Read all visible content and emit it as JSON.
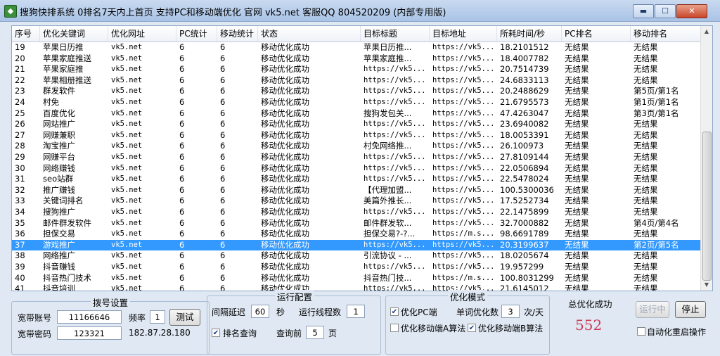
{
  "window": {
    "title": "搜狗快排系统 0排名7天内上首页 支持PC和移动端优化 官网 vk5.net 客服QQ 804520209 (内部专用版)",
    "min_icon": "minimize-icon",
    "max_icon": "maximize-icon",
    "close_icon": "close-icon"
  },
  "table": {
    "columns": [
      "序号",
      "优化关键词",
      "优化网址",
      "PC统计",
      "移动统计",
      "状态",
      "目标标题",
      "目标地址",
      "所耗时间/秒",
      "PC排名",
      "移动排名"
    ],
    "selected_row": 18,
    "rows": [
      [
        "19",
        "苹果日历推",
        "vk5.net",
        "6",
        "6",
        "移动优化成功",
        "苹果日历推...",
        "https://vk5...",
        "18.2101512",
        "无结果",
        "无结果"
      ],
      [
        "20",
        "苹果家庭推送",
        "vk5.net",
        "6",
        "6",
        "移动优化成功",
        "苹果家庭推...",
        "https://vk5...",
        "18.4007782",
        "无结果",
        "无结果"
      ],
      [
        "21",
        "苹果家庭推",
        "vk5.net",
        "6",
        "6",
        "移动优化成功",
        "https://vk5...",
        "https://vk5...",
        "20.7514739",
        "无结果",
        "无结果"
      ],
      [
        "22",
        "苹果相册推送",
        "vk5.net",
        "6",
        "6",
        "移动优化成功",
        "https://vk5...",
        "https://vk5...",
        "24.6833113",
        "无结果",
        "无结果"
      ],
      [
        "23",
        "群发软件",
        "vk5.net",
        "6",
        "6",
        "移动优化成功",
        "https://vk5...",
        "https://vk5...",
        "20.2488629",
        "无结果",
        "第5页/第1名"
      ],
      [
        "24",
        "村免",
        "vk5.net",
        "6",
        "6",
        "移动优化成功",
        "https://vk5...",
        "https://vk5...",
        "21.6795573",
        "无结果",
        "第1页/第1名"
      ],
      [
        "25",
        "百度优化",
        "vk5.net",
        "6",
        "6",
        "移动优化成功",
        "搜狗发包关...",
        "https://vk5...",
        "47.4263047",
        "无结果",
        "第3页/第1名"
      ],
      [
        "26",
        "网站推广",
        "vk5.net",
        "6",
        "6",
        "移动优化成功",
        "https://vk5...",
        "https://vk5...",
        "23.6940082",
        "无结果",
        "无结果"
      ],
      [
        "27",
        "网赚兼职",
        "vk5.net",
        "6",
        "6",
        "移动优化成功",
        "https://vk5...",
        "https://vk5...",
        "18.0053391",
        "无结果",
        "无结果"
      ],
      [
        "28",
        "淘宝推广",
        "vk5.net",
        "6",
        "6",
        "移动优化成功",
        "村免网络推...",
        "https://vk5...",
        "26.100973",
        "无结果",
        "无结果"
      ],
      [
        "29",
        "网赚平台",
        "vk5.net",
        "6",
        "6",
        "移动优化成功",
        "https://vk5...",
        "https://vk5...",
        "27.8109144",
        "无结果",
        "无结果"
      ],
      [
        "30",
        "网络赚钱",
        "vk5.net",
        "6",
        "6",
        "移动优化成功",
        "https://vk5...",
        "https://vk5...",
        "22.0506894",
        "无结果",
        "无结果"
      ],
      [
        "31",
        "seo站群",
        "vk5.net",
        "6",
        "6",
        "移动优化成功",
        "https://vk5...",
        "https://vk5...",
        "22.5478024",
        "无结果",
        "无结果"
      ],
      [
        "32",
        "推广赚钱",
        "vk5.net",
        "6",
        "6",
        "移动优化成功",
        "【代理加盟...",
        "https://vk5...",
        "100.5300036",
        "无结果",
        "无结果"
      ],
      [
        "33",
        "关键词排名",
        "vk5.net",
        "6",
        "6",
        "移动优化成功",
        "美篇外推长...",
        "https://vk5...",
        "17.5252734",
        "无结果",
        "无结果"
      ],
      [
        "34",
        "搜狗推广",
        "vk5.net",
        "6",
        "6",
        "移动优化成功",
        "https://vk5...",
        "https://vk5...",
        "22.1475899",
        "无结果",
        "无结果"
      ],
      [
        "35",
        "邮件群发软件",
        "vk5.net",
        "6",
        "6",
        "移动优化成功",
        "邮件群发软...",
        "https://vk5...",
        "32.7000882",
        "无结果",
        "第4页/第4名"
      ],
      [
        "36",
        "担保交易",
        "vk5.net",
        "6",
        "6",
        "移动优化成功",
        "担保交易?-?...",
        "https://m.s...",
        "98.6691789",
        "无结果",
        "无结果"
      ],
      [
        "37",
        "游戏推广",
        "vk5.net",
        "6",
        "6",
        "移动优化成功",
        "https://vk5...",
        "https://vk5...",
        "20.3199637",
        "无结果",
        "第2页/第5名"
      ],
      [
        "38",
        "网络推广",
        "vk5.net",
        "6",
        "6",
        "移动优化成功",
        "引流协议 - ...",
        "https://vk5...",
        "18.0205674",
        "无结果",
        "无结果"
      ],
      [
        "39",
        "抖音赚钱",
        "vk5.net",
        "6",
        "6",
        "移动优化成功",
        "https://vk5...",
        "https://vk5...",
        "19.957299",
        "无结果",
        "无结果"
      ],
      [
        "40",
        "抖音热门技术",
        "vk5.net",
        "6",
        "6",
        "移动优化成功",
        "抖音热门技...",
        "https://m.s...",
        "100.8031299",
        "无结果",
        "无结果"
      ],
      [
        "41",
        "抖音培训",
        "vk5.net",
        "6",
        "6",
        "移动优化成功",
        "https://vk5...",
        "https://vk5...",
        "21.6145012",
        "无结果",
        "无结果"
      ]
    ]
  },
  "dial": {
    "title": "拨号设置",
    "account_label": "宽带账号",
    "account_value": "11166646",
    "password_label": "宽带密码",
    "password_value": "123321",
    "freq_label": "频率",
    "freq_value": "1",
    "test_button": "测试",
    "ip": "182.87.28.180"
  },
  "run": {
    "title": "运行配置",
    "interval_label": "间隔延迟",
    "interval_value": "60",
    "interval_unit": "秒",
    "threads_label": "运行线程数",
    "threads_value": "1",
    "rank_query_label": "排名查询",
    "rank_query_checked": true,
    "query_before_label": "查询前",
    "query_before_value": "5",
    "query_before_unit": "页"
  },
  "mode": {
    "title": "优化模式",
    "pc_label": "优化PC端",
    "pc_checked": true,
    "per_word_label": "单词优化数",
    "per_word_value": "3",
    "per_word_unit": "次/天",
    "mobile_a_label": "优化移动端A算法",
    "mobile_a_checked": false,
    "mobile_b_label": "优化移动端B算法",
    "mobile_b_checked": true
  },
  "total": {
    "title": "总优化成功",
    "value": "552"
  },
  "actions": {
    "running_button": "运行中",
    "stop_button": "停止",
    "auto_restart_label": "自动化重启操作",
    "auto_restart_checked": false
  }
}
